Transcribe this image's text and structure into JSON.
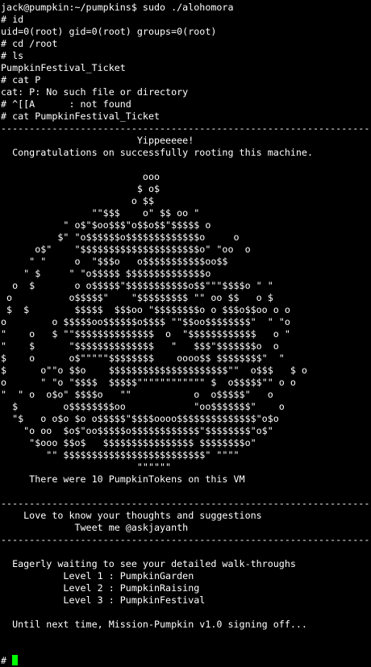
{
  "terminal": {
    "lines": [
      "jack@pumpkin:~/pumpkins$ sudo ./alohomora",
      "# id",
      "uid=0(root) gid=0(root) groups=0(root)",
      "# cd /root",
      "# ls",
      "PumpkinFestival_Ticket",
      "# cat P",
      "cat: P: No such file or directory",
      "# ^[[A      : not found",
      "# cat PumpkinFestival_Ticket",
      "-----------------------------------------------------------------",
      "                        Yippeeeee!",
      "  Congratulations on successfully rooting this machine.",
      "",
      "                         ooo",
      "                        $ o$",
      "                       o $$",
      "                \"\"$$$    o\" $$ oo \"",
      "           \" o$\"$oo$$$\"o$$o$$\"$$$$$ o",
      "          $\" \"o$$$$$$o$$$$$$$$$$$$$o     o",
      "      o$\"    \"$$$$$$$$$$$$$$$$$$$$$o\" \"oo  o",
      "     \" \"     o  \"$$$o   o$$$$$$$$$$$oo$$",
      "    \" $     \" \"o$$$$$ $$$$$$$$$$$$$$o",
      "  o  $       o o$$$$$\"$$$$$$$$$$$o$$\"\"\"$$$$o \" \"",
      " o          o$$$$$\"    \"$$$$$$$$$ \"\" oo $$   o $",
      " $  $        $$$$$  $$$oo \"$$$$$$$$o o $$$o$$oo o o",
      "o        o $$$$$oo$$$$$$o$$$$ \"\"$$oo$$$$$$$$\"  \" \"o",
      "\"    o   $ \"\"$$$$$$$$$$$$$$  o  \"$$$$$$$$$$$$   o \"",
      "\"    $      \"$$$$$$$$$$$$$$   \"   $$$\"$$$$$$$o  o",
      "$    o      o$\"\"\"\"\"$$$$$$$$    oooo$$ $$$$$$$$\"  \"",
      "$      o\"\"o $$o    $$$$$$$$$$$$$$$$$$$$$\"\"  o$$$   $ o",
      "o      \" \"o \"$$$$  $$$$$\"\"\"\"\"\"\"\"\"\"\"\" $  o$$$$$\"\" o o",
      "\"  \" o  o$o\" $$$$o   \"\"           o  o$$$$$\"   o",
      "  $        o$$$$$$$$oo            \"oo$$$$$$$\"    o",
      "  \"$   o o$o $o o$$$$$\"$$$$oooo$$$$$$$$$$$$$$\"o$o",
      "    \"o oo  $o$\"oo$$$$$o$$$$$$$$$$$$\"$$$$$$$$\"o$\"",
      "     \"$ooo $$o$   $$$$$$$$$$$$$$$$ $$$$$$$$o\"",
      "        \"\" $$$$$$$$$$$$$$$$$$$$$$$$$\" \"\"\"\"",
      "                        \"\"\"\"\"\"",
      "     There were 10 PumpkinTokens on this VM",
      "",
      "-----------------------------------------------------------------",
      "    Love to know your thoughts and suggestions",
      "             Tweet me @askjayanth",
      "-----------------------------------------------------------------",
      "",
      "  Eagerly waiting to see your detailed walk-throughs",
      "           Level 1 : PumpkinGarden",
      "           Level 2 : PumpkinRaising",
      "           Level 3 : PumpkinFestival",
      "",
      "  Until next time, Mission-Pumpkin v1.0 signing off...",
      "",
      ""
    ],
    "prompt": "#",
    "cursor_color": "#00ff00",
    "text_color": "#ffffff",
    "background_color": "#000000"
  }
}
